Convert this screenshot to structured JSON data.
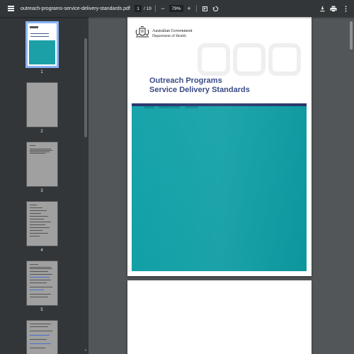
{
  "toolbar": {
    "file_name": "outreach-programs-service-delivery-standards.pdf",
    "current_page": "1",
    "page_total": "/ 19",
    "zoom_minus": "−",
    "zoom": "79%",
    "zoom_plus": "+"
  },
  "icons": [
    "menu-icon",
    "fit-page-icon",
    "rotate-icon",
    "download-icon",
    "print-icon",
    "more-options-icon"
  ],
  "thumbnails": [
    {
      "number": "1",
      "selected": true
    },
    {
      "number": "2",
      "selected": false
    },
    {
      "number": "3",
      "selected": false
    },
    {
      "number": "4",
      "selected": false
    },
    {
      "number": "5",
      "selected": false
    }
  ],
  "document": {
    "gov_line1": "Australian Government",
    "gov_line2": "Department of Health",
    "title_line1": "Outreach Programs",
    "title_line2": "Service Delivery Standards"
  },
  "colors": {
    "toolbar": "#323639",
    "viewer_bg": "#525659",
    "title_blue": "#3a4b86",
    "teal": "#12a1a7",
    "navy_strip": "#2a3a6e",
    "selection": "#8ab4f8"
  }
}
